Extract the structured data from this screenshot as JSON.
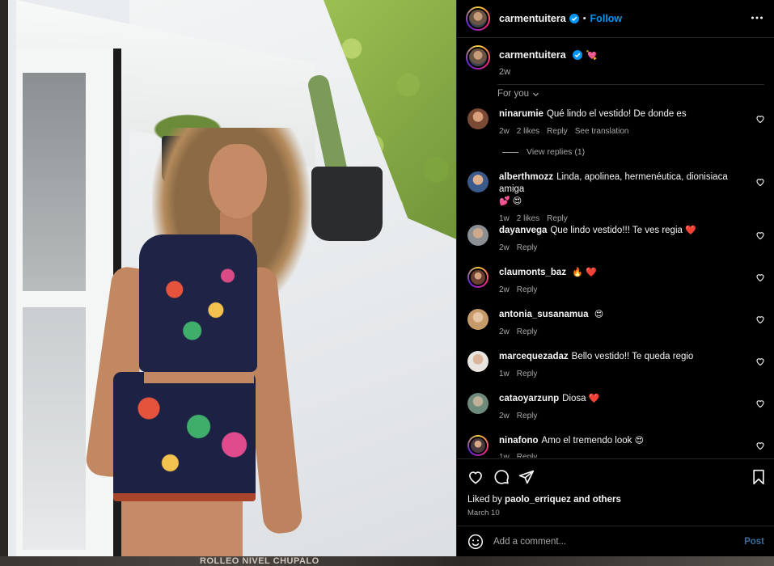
{
  "backdrop": {
    "caption": "ROLLEO NIVEL CHUPALO"
  },
  "post": {
    "username": "carmentuitera",
    "follow_label": "Follow",
    "separator": "•",
    "caption_emoji": "💘",
    "caption_time": "2w",
    "sort_label": "For you",
    "liked_by_prefix": "Liked by",
    "liked_by_user": "paolo_erriquez",
    "liked_by_suffix": "and others",
    "date": "March 10",
    "comment_placeholder": "Add a comment...",
    "post_label": "Post"
  },
  "comments": [
    {
      "user": "ninarumie",
      "text": "Qué lindo el vestido! De donde es",
      "time": "2w",
      "likes": "2 likes",
      "reply": "Reply",
      "translation": "See translation",
      "view_replies": "View replies (1)"
    },
    {
      "user": "alberthmozz",
      "text": "Linda, apolinea, hermenéutica, dionisiaca amiga",
      "emoji": "💕 😍",
      "time": "1w",
      "likes": "2 likes",
      "reply": "Reply"
    },
    {
      "user": "dayanvega",
      "text": "Que lindo vestido!!! Te ves regia",
      "emoji": "❤️",
      "time": "2w",
      "reply": "Reply"
    },
    {
      "user": "claumonts_baz",
      "text": "",
      "emoji": "🔥 ❤️",
      "time": "2w",
      "reply": "Reply"
    },
    {
      "user": "antonia_susanamua",
      "text": "",
      "emoji": "😍",
      "time": "2w",
      "reply": "Reply"
    },
    {
      "user": "marcequezadaz",
      "text": "Bello vestido!! Te queda regio",
      "time": "1w",
      "reply": "Reply"
    },
    {
      "user": "cataoyarzunp",
      "text": "Diosa",
      "emoji": "❤️",
      "time": "2w",
      "reply": "Reply"
    },
    {
      "user": "ninafono",
      "text": "Amo el tremendo look",
      "emoji": "😍",
      "time": "1w",
      "reply": "Reply"
    }
  ],
  "colors": {
    "accent": "#0095f6",
    "background": "#000000",
    "muted": "#a8a8a8",
    "heart_red": "#ff3040"
  },
  "icons": [
    "verified-badge-icon",
    "more-options-icon",
    "chevron-down-icon",
    "heart-icon",
    "comment-icon",
    "share-icon",
    "bookmark-icon",
    "emoji-icon"
  ]
}
